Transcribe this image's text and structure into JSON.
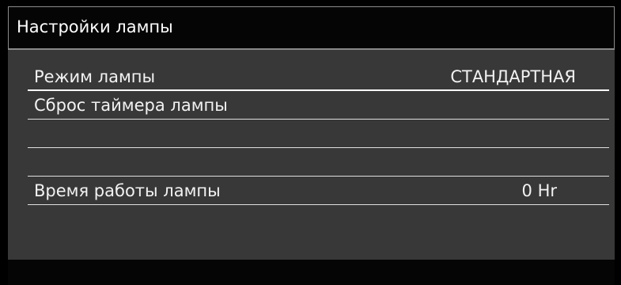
{
  "menu": {
    "title": "Настройки лампы",
    "items": [
      {
        "label": "Режим лампы",
        "value": "СТАНДАРТНАЯ"
      },
      {
        "label": "Сброс таймера лампы",
        "value": ""
      },
      {
        "label": "",
        "value": ""
      },
      {
        "label": "",
        "value": ""
      },
      {
        "label": "Время работы лампы",
        "value": "0  Hr"
      }
    ]
  },
  "colors": {
    "panel_background": "#383838",
    "title_background": "#050505",
    "text": "#ffffff",
    "divider": "#e0e0e0"
  }
}
